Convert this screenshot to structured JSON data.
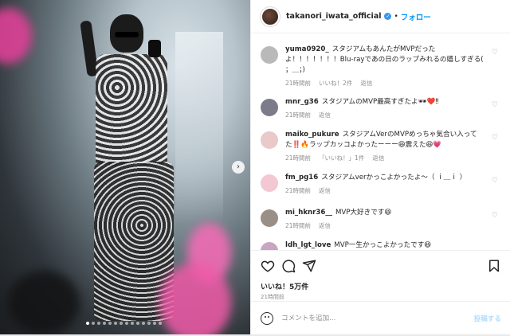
{
  "header": {
    "username": "takanori_iwata_official",
    "separator": "•",
    "follow_label": "フォロー"
  },
  "comments": [
    {
      "user": "yuma0920_",
      "text": "スタジアムもあんたがMVPだったよ！！！！！！！Blu-rayであの日のラップみれるの嬉しすぎる( ；＿；)",
      "time": "21時間前",
      "likes": "いいね！2件",
      "reply": "返信",
      "avatar_color": "#b9b9b9"
    },
    {
      "user": "mnr_g36",
      "text": "スタジアムのMVP最高すぎたよ🕶❤️‼︎",
      "time": "21時間前",
      "likes": "",
      "reply": "返信",
      "avatar_color": "#7b7b8a"
    },
    {
      "user": "maiko_pukure",
      "text": "スタジアムVerのMVPめっちゃ気合い入ってた‼️🔥ラップカッコよかったーーー😆震えた😆💗",
      "time": "21時間前",
      "likes": "「いいね！」1件",
      "reply": "返信",
      "avatar_color": "#e9c9c9"
    },
    {
      "user": "fm_pg16",
      "text": "スタジアムverかっこよかったよ〜（ ｉ＿ｉ ）",
      "time": "21時間前",
      "likes": "",
      "reply": "返信",
      "avatar_color": "#f3c7d3"
    },
    {
      "user": "mi_hknr36__",
      "text": "MVP大好きです😆",
      "time": "21時間前",
      "likes": "",
      "reply": "返信",
      "avatar_color": "#9a8f86"
    },
    {
      "user": "ldh_lgt_love",
      "text": "MVP一生かっこよかったです😆",
      "time": "",
      "likes": "",
      "reply": "",
      "avatar_color": "#c8a5c0"
    }
  ],
  "actions": {
    "likes_text": "いいね！5万件",
    "timestamp": "21時間前"
  },
  "composer": {
    "placeholder": "コメントを追加...",
    "post_label": "投稿する"
  },
  "carousel": {
    "dot_count": 14,
    "active_index": 0
  },
  "icons": {
    "heart": "heart-icon",
    "comment": "comment-icon",
    "share": "share-icon",
    "bookmark": "bookmark-icon",
    "emoji": "emoji-icon",
    "next": "chevron-right-icon"
  }
}
